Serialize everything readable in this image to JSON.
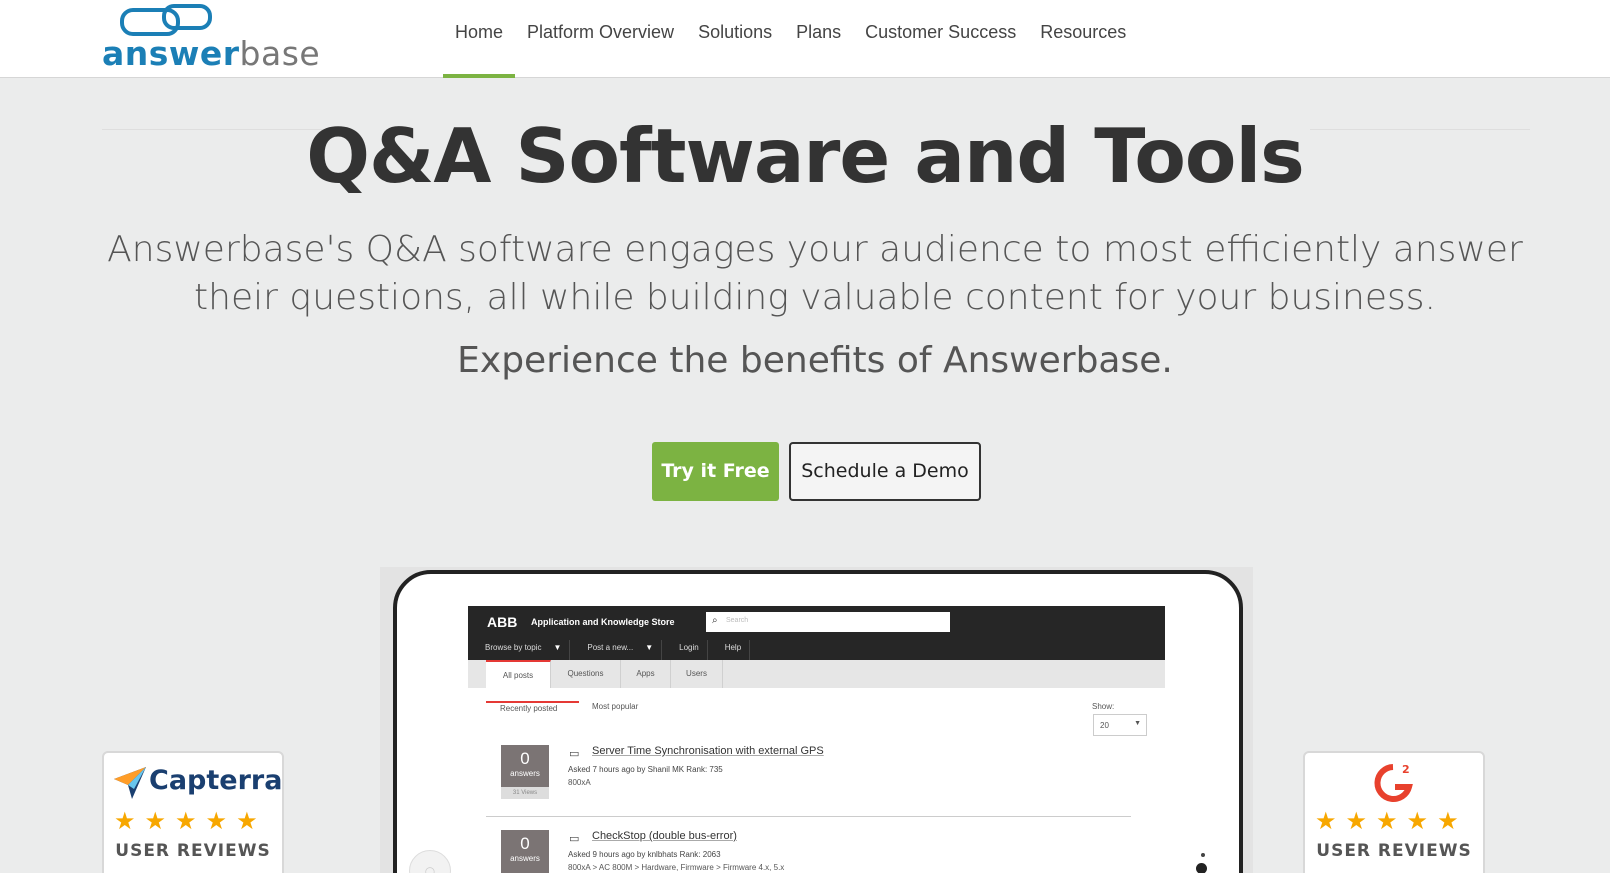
{
  "brand": {
    "logo_part1": "answer",
    "logo_part2": "base"
  },
  "nav": [
    {
      "label": "Home",
      "active": true
    },
    {
      "label": "Platform Overview"
    },
    {
      "label": "Solutions"
    },
    {
      "label": "Plans"
    },
    {
      "label": "Customer Success"
    },
    {
      "label": "Resources"
    }
  ],
  "hero": {
    "title": "Q&A Software and Tools",
    "subtitle": "Answerbase's Q&A software engages your audience to most efficiently answer their questions, all while building valuable content for your business.",
    "experience": "Experience the benefits of Answerbase.",
    "try_label": "Try it Free",
    "demo_label": "Schedule a Demo"
  },
  "screen": {
    "brand": "ABB",
    "store_title": "Application and Knowledge Store",
    "search_placeholder": "Search",
    "menu": [
      "Browse by topic",
      "Post a new...",
      "Login",
      "Help"
    ],
    "tabs": [
      "All posts",
      "Questions",
      "Apps",
      "Users"
    ],
    "sort_tabs": [
      "Recently posted",
      "Most popular"
    ],
    "show_label": "Show:",
    "show_value": "20",
    "questions": [
      {
        "answers": "0",
        "answers_label": "answers",
        "views": "31 Views",
        "title": "Server Time Synchronisation with external GPS",
        "meta": "Asked 7 hours ago by Shanil MK      Rank: 735",
        "tags": "800xA"
      },
      {
        "answers": "0",
        "answers_label": "answers",
        "views": "",
        "title": "CheckStop (double bus-error)",
        "meta": "Asked 9 hours ago by knlbhats      Rank: 2063",
        "tags": "800xA > AC 800M > Hardware, Firmware > Firmware 4.x, 5.x"
      }
    ]
  },
  "badges": {
    "capterra_name": "Capterra",
    "capterra_label": "USER REVIEWS",
    "g2_label": "USER REVIEWS",
    "stars": "★★★★★"
  },
  "colors": {
    "accent": "#7cb342",
    "logo_blue": "#1b7fb6",
    "capterra_navy": "#1a3f70",
    "star": "#f7a700"
  }
}
